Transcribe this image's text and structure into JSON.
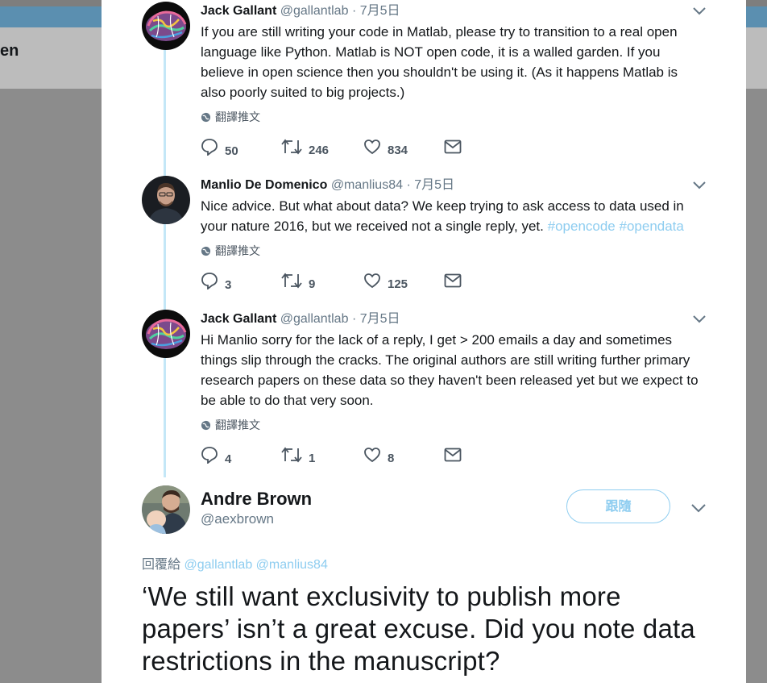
{
  "background": {
    "header_fragment": "en"
  },
  "thread": [
    {
      "name": "Jack Gallant",
      "handle": "@gallantlab",
      "separator": "·",
      "date": "7月5日",
      "text": "If you are still writing your code in Matlab, please try to transition to a real open language like Python. Matlab is NOT open code, it is a walled garden. If you believe in open science then you shouldn't be using it. (As it happens Matlab is also poorly suited to big projects.)",
      "translate_label": "翻譯推文",
      "replies": "50",
      "retweets": "246",
      "likes": "834",
      "avatar_icon": "brain-avatar-icon"
    },
    {
      "name": "Manlio De Domenico",
      "handle": "@manlius84",
      "separator": "·",
      "date": "7月5日",
      "text": "Nice advice. But what about data? We keep trying to ask access to data used in your nature 2016, but we received not a single reply, yet.",
      "hashtags": [
        "#opencode",
        "#opendata"
      ],
      "translate_label": "翻譯推文",
      "replies": "3",
      "retweets": "9",
      "likes": "125",
      "avatar_icon": "person-avatar-icon"
    },
    {
      "name": "Jack Gallant",
      "handle": "@gallantlab",
      "separator": "·",
      "date": "7月5日",
      "text": "Hi Manlio sorry for the lack of a reply, I get > 200 emails a day and sometimes things slip through the cracks. The original authors are still writing further primary research papers on these data so they haven't been released yet but we expect to be able to do that very soon.",
      "translate_label": "翻譯推文",
      "replies": "4",
      "retweets": "1",
      "likes": "8",
      "avatar_icon": "brain-avatar-icon"
    }
  ],
  "main_tweet": {
    "name": "Andre Brown",
    "handle": "@aexbrown",
    "follow_label": "跟隨",
    "reply_prefix": "回覆給",
    "reply_mentions": [
      "@gallantlab",
      "@manlius84"
    ],
    "text": "‘We still want exclusivity to publish more papers’ isn’t a great excuse. Did you note data restrictions in the manuscript?"
  },
  "colors": {
    "accent_light": "#8ecdf0",
    "text_primary": "#14171a",
    "text_secondary": "#657786",
    "thread_line": "#c4e7f7"
  }
}
